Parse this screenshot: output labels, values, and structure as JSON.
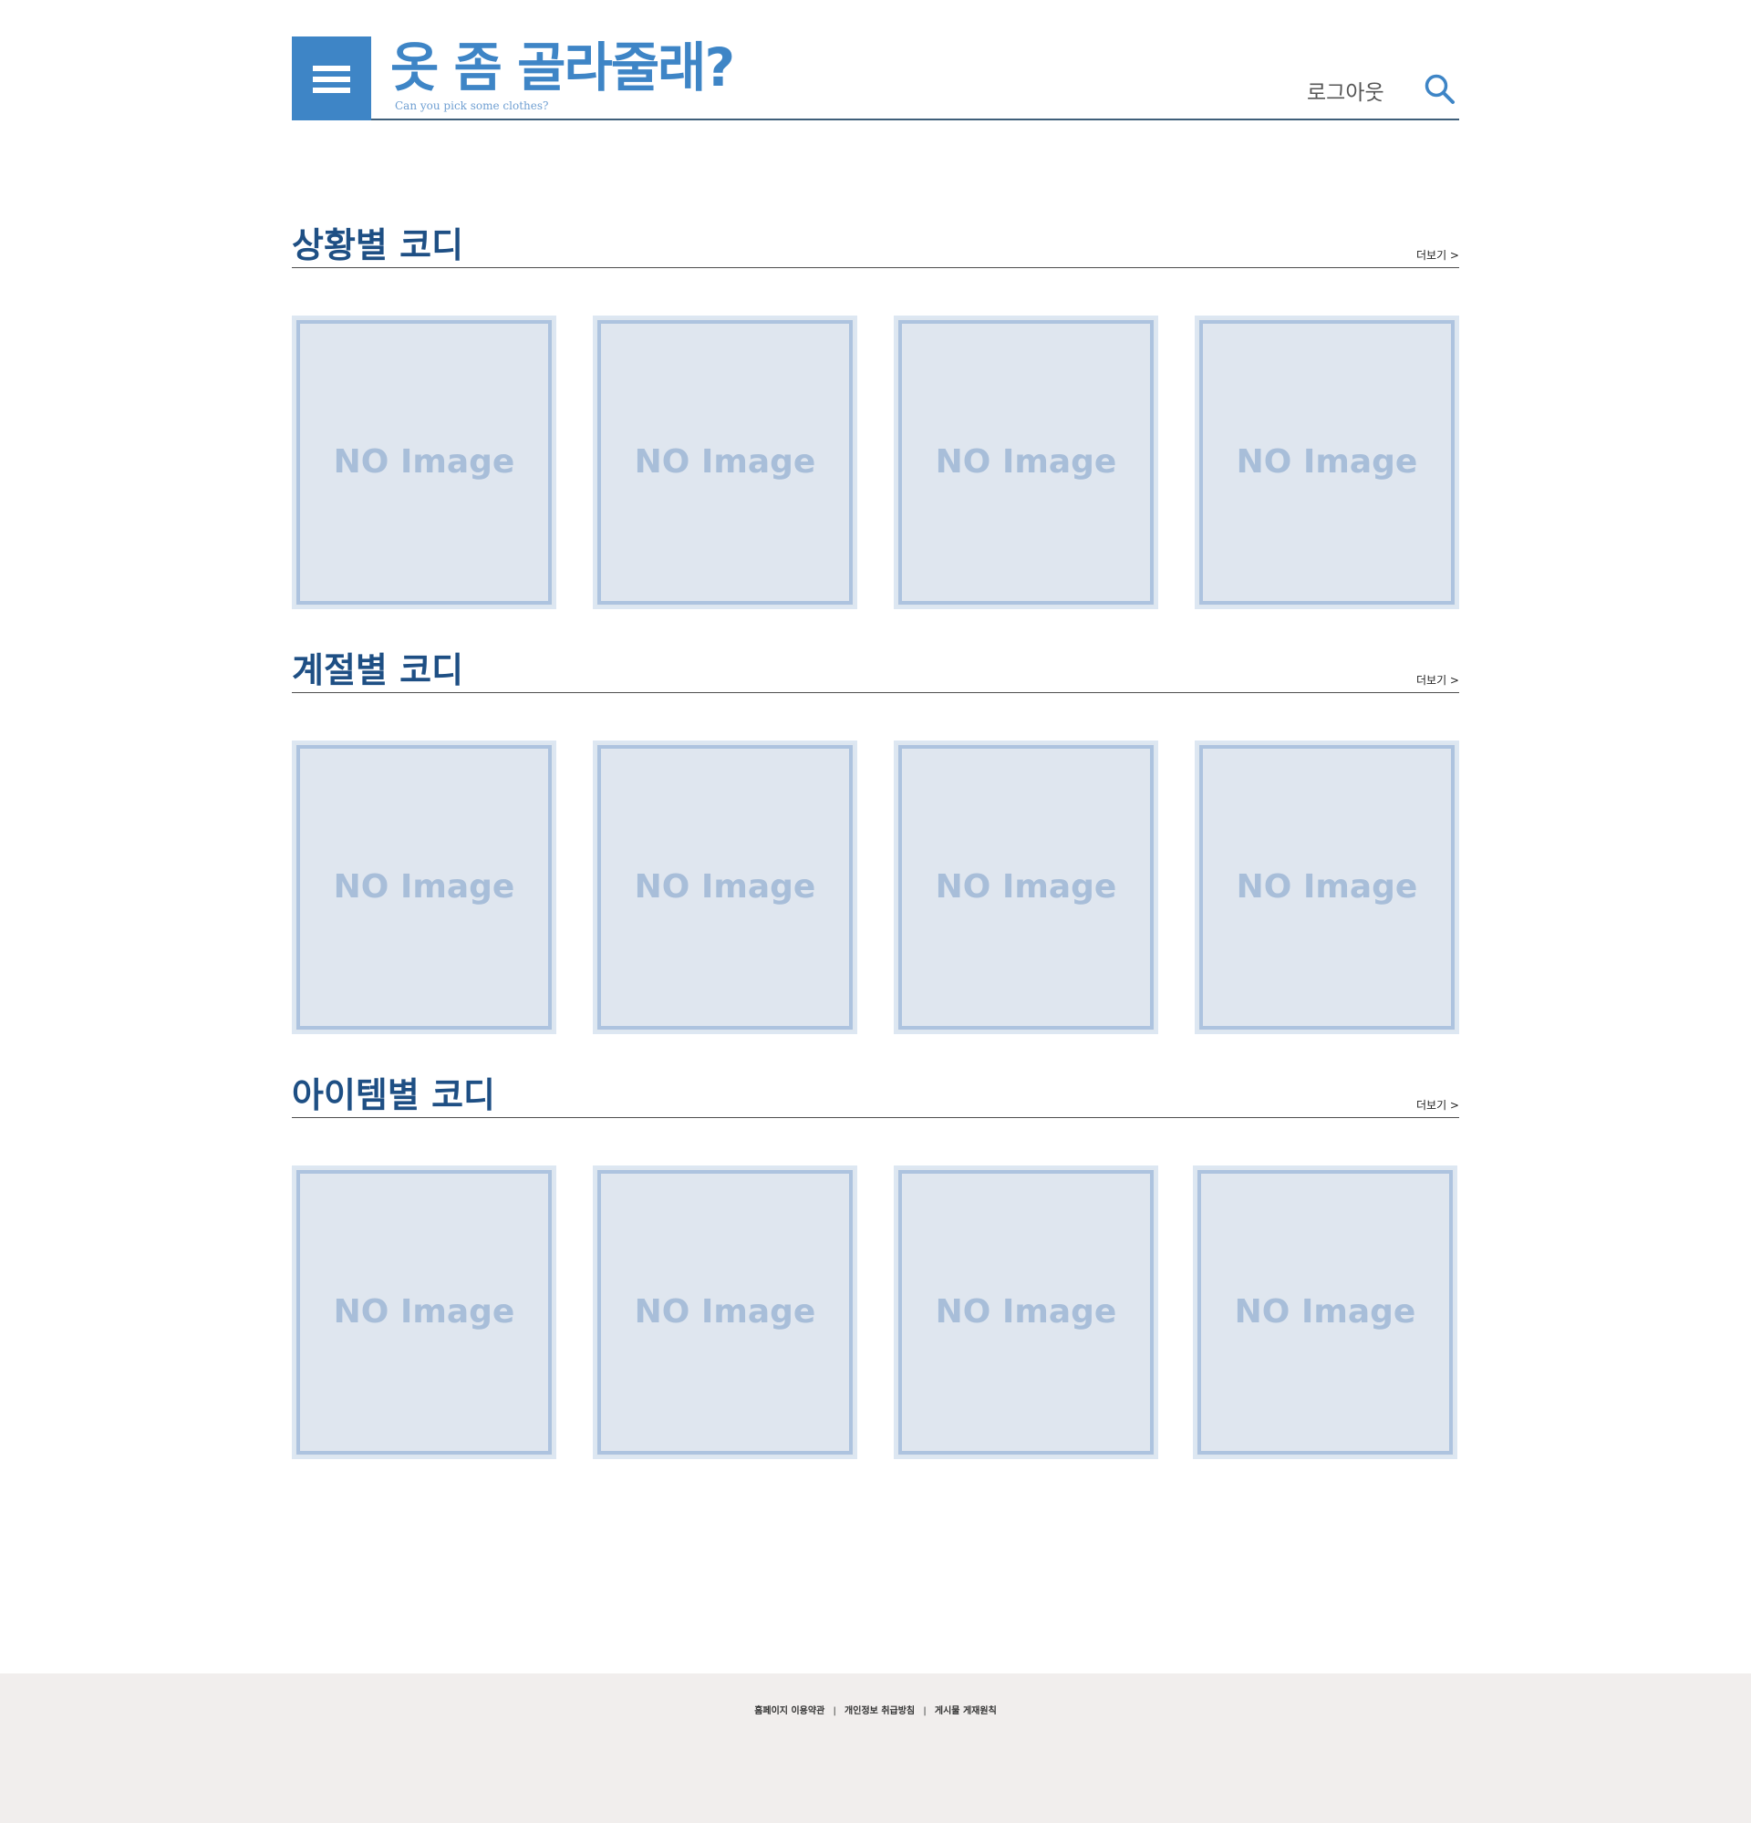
{
  "header": {
    "title": "옷 좀 골라줄래?",
    "subtitle": "Can you pick some clothes?",
    "logout_label": "로그아웃",
    "menu_icon": "hamburger-menu-icon",
    "search_icon": "search-icon",
    "accent_color": "#3e85c6"
  },
  "sections": [
    {
      "title": "상황별 코디",
      "more_label": "더보기 >",
      "cards": [
        {
          "label": "NO Image"
        },
        {
          "label": "NO Image"
        },
        {
          "label": "NO Image"
        },
        {
          "label": "NO Image"
        }
      ]
    },
    {
      "title": "계절별 코디",
      "more_label": "더보기 >",
      "cards": [
        {
          "label": "NO Image"
        },
        {
          "label": "NO Image"
        },
        {
          "label": "NO Image"
        },
        {
          "label": "NO Image"
        }
      ]
    },
    {
      "title": "아이템별 코디",
      "more_label": "더보기 >",
      "cards": [
        {
          "label": "NO Image"
        },
        {
          "label": "NO Image"
        },
        {
          "label": "NO Image"
        },
        {
          "label": "NO Image"
        }
      ]
    }
  ],
  "footer": {
    "links": [
      {
        "label": "홈페이지 이용약관"
      },
      {
        "label": "개인정보 취급방침"
      },
      {
        "label": "게시물 게재원칙"
      }
    ],
    "separator": "|"
  }
}
